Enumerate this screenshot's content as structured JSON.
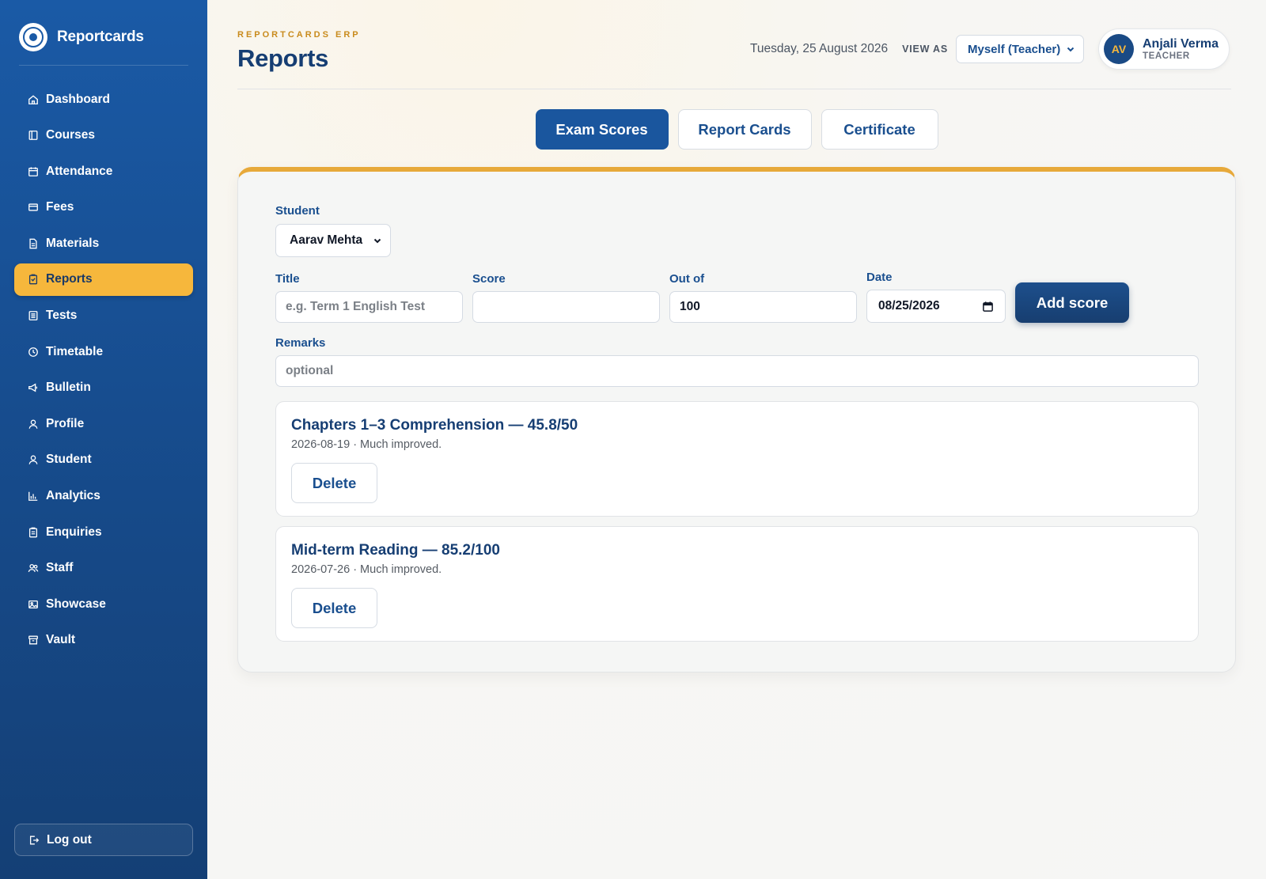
{
  "brand": {
    "name": "Reportcards"
  },
  "sidebar": {
    "items": [
      {
        "label": "Dashboard",
        "icon": "home-icon"
      },
      {
        "label": "Courses",
        "icon": "book-icon"
      },
      {
        "label": "Attendance",
        "icon": "calendar-icon"
      },
      {
        "label": "Fees",
        "icon": "wallet-icon"
      },
      {
        "label": "Materials",
        "icon": "file-icon"
      },
      {
        "label": "Reports",
        "icon": "clipboard-icon",
        "active": true
      },
      {
        "label": "Tests",
        "icon": "list-icon"
      },
      {
        "label": "Timetable",
        "icon": "clock-icon"
      },
      {
        "label": "Bulletin",
        "icon": "megaphone-icon"
      },
      {
        "label": "Profile",
        "icon": "user-icon"
      },
      {
        "label": "Student",
        "icon": "user-icon"
      },
      {
        "label": "Analytics",
        "icon": "bar-chart-icon"
      },
      {
        "label": "Enquiries",
        "icon": "clipboard-list-icon"
      },
      {
        "label": "Staff",
        "icon": "users-icon"
      },
      {
        "label": "Showcase",
        "icon": "image-icon"
      },
      {
        "label": "Vault",
        "icon": "archive-icon"
      }
    ],
    "logout_label": "Log out"
  },
  "header": {
    "eyebrow": "REPORTCARDS ERP",
    "title": "Reports",
    "date": "Tuesday, 25 August 2026",
    "view_as_label": "VIEW AS",
    "view_as_value": "Myself (Teacher)",
    "user": {
      "initials": "AV",
      "name": "Anjali Verma",
      "role": "TEACHER"
    }
  },
  "tabs": [
    {
      "label": "Exam Scores",
      "active": true
    },
    {
      "label": "Report Cards",
      "active": false
    },
    {
      "label": "Certificate",
      "active": false
    }
  ],
  "form": {
    "student_label": "Student",
    "student_value": "Aarav Mehta",
    "title_label": "Title",
    "title_placeholder": "e.g. Term 1 English Test",
    "score_label": "Score",
    "score_value": "",
    "outof_label": "Out of",
    "outof_value": "100",
    "date_label": "Date",
    "date_value": "08/25/2026",
    "remarks_label": "Remarks",
    "remarks_placeholder": "optional",
    "add_button": "Add score"
  },
  "scores": [
    {
      "title": "Chapters 1–3 Comprehension — 45.8/50",
      "meta": "2026-08-19 · Much improved.",
      "delete_label": "Delete"
    },
    {
      "title": "Mid-term Reading — 85.2/100",
      "meta": "2026-07-26 · Much improved.",
      "delete_label": "Delete"
    }
  ],
  "colors": {
    "accent": "#f6b73c",
    "primary": "#1a569e",
    "sidebar": "#174d8f"
  }
}
